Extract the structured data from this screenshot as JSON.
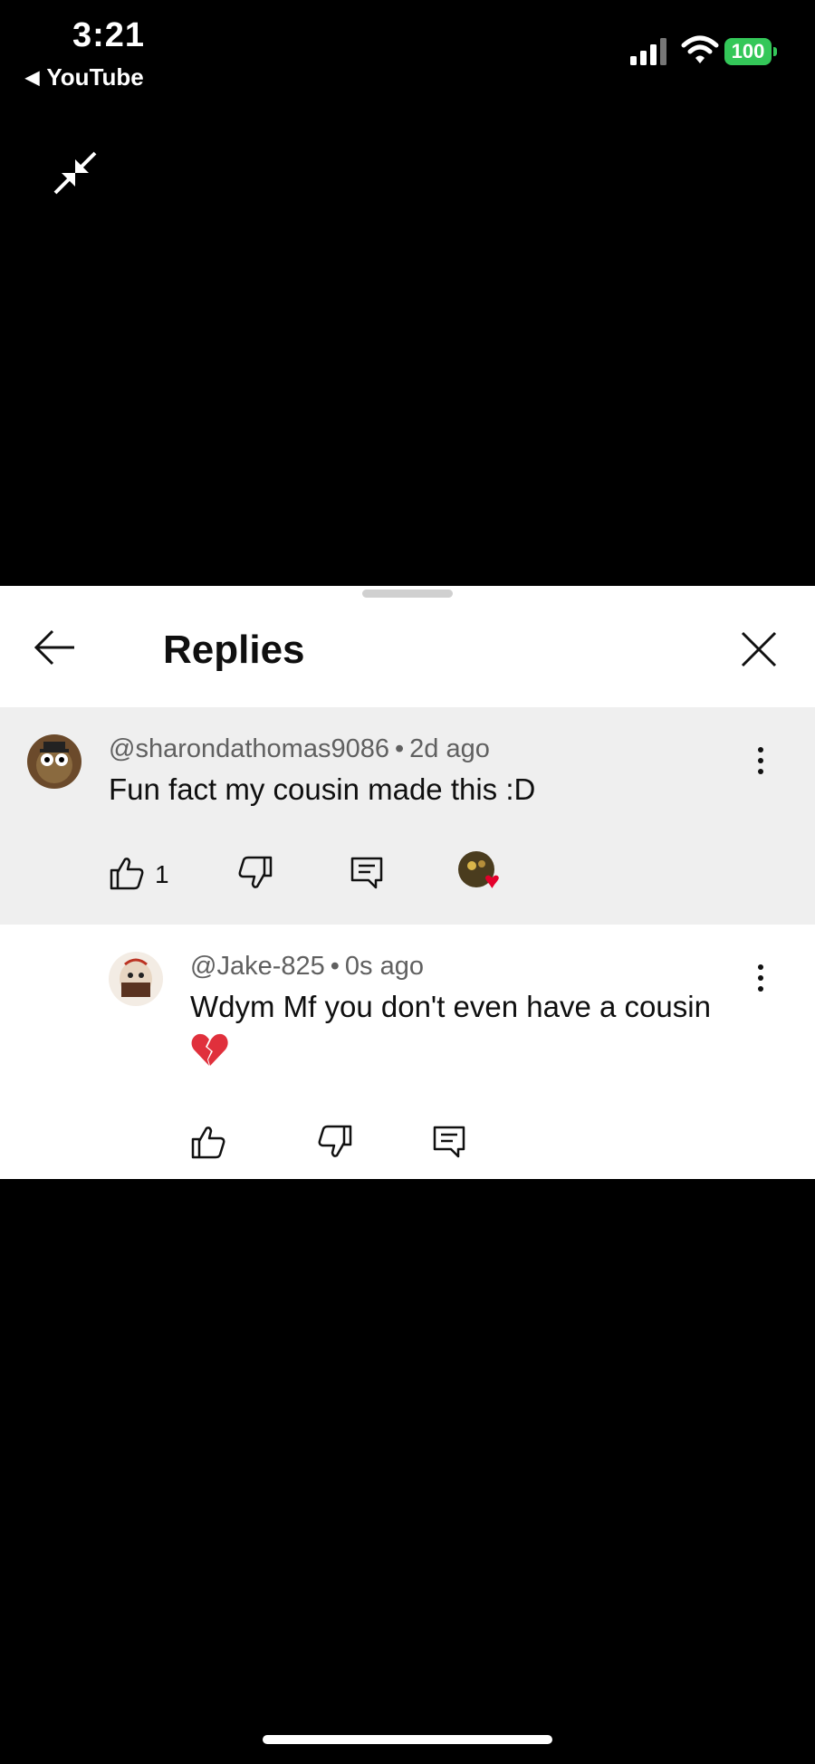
{
  "status_bar": {
    "time": "3:21",
    "back_app": "YouTube",
    "battery": "100"
  },
  "sheet": {
    "title": "Replies"
  },
  "comments": [
    {
      "author": "@sharondathomas9086",
      "age": "2d ago",
      "text": "Fun fact my cousin made this :D",
      "likes": "1",
      "creator_heart": true
    },
    {
      "author": "@Jake-825",
      "age": "0s ago",
      "text": "Wdym Mf you don't even have a cousin",
      "emoji": "broken-heart-icon"
    }
  ],
  "icons": {
    "status": [
      "cellular-signal-icon",
      "wifi-icon",
      "battery-icon"
    ],
    "video": [
      "exit-fullscreen-icon"
    ],
    "sheet": [
      "back-arrow-icon",
      "close-icon"
    ],
    "actions": [
      "thumbs-up-icon",
      "thumbs-down-icon",
      "reply-icon",
      "more-vertical-icon"
    ]
  },
  "colors": {
    "battery": "#34c759",
    "selected_comment_bg": "#efefef",
    "heart": "#e4002b"
  }
}
